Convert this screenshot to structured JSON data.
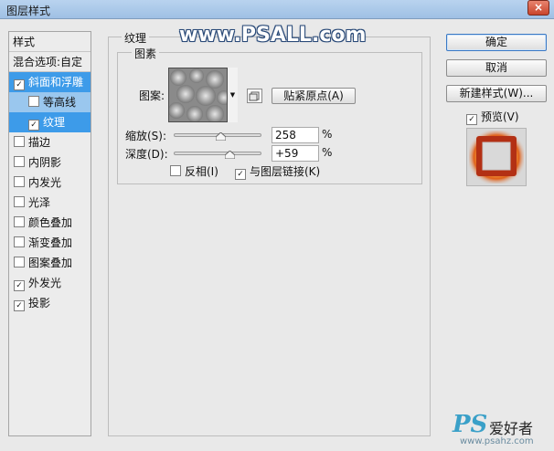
{
  "window": {
    "title": "图层样式",
    "close_glyph": "×"
  },
  "left_panel": {
    "header": "样式",
    "blend_options": "混合选项:自定",
    "items": [
      {
        "label": "斜面和浮雕",
        "checked": true
      },
      {
        "label": "等高线",
        "checked": false
      },
      {
        "label": "纹理",
        "checked": true
      },
      {
        "label": "描边",
        "checked": false
      },
      {
        "label": "内阴影",
        "checked": false
      },
      {
        "label": "内发光",
        "checked": false
      },
      {
        "label": "光泽",
        "checked": false
      },
      {
        "label": "颜色叠加",
        "checked": false
      },
      {
        "label": "渐变叠加",
        "checked": false
      },
      {
        "label": "图案叠加",
        "checked": false
      },
      {
        "label": "外发光",
        "checked": true
      },
      {
        "label": "投影",
        "checked": true
      }
    ]
  },
  "texture_group": {
    "title": "纹理",
    "elements_title": "图素",
    "pattern_label": "图案:",
    "snap_origin_button": "贴紧原点(A)",
    "scale": {
      "label": "缩放(S):",
      "value": "258",
      "unit": "%",
      "slider_fraction": 0.54
    },
    "depth": {
      "label": "深度(D):",
      "value": "+59",
      "unit": "%",
      "slider_fraction": 0.64
    },
    "invert": {
      "label": "反相(I)",
      "checked": false
    },
    "link_with_layer": {
      "label": "与图层链接(K)",
      "checked": true
    }
  },
  "buttons": {
    "ok": "确定",
    "cancel": "取消",
    "new_style": "新建样式(W)...",
    "preview": {
      "label": "预览(V)",
      "checked": true
    }
  },
  "watermarks": {
    "top": "www.PSALL.com",
    "bottom_logo_ps": "PS",
    "bottom_logo_cn": "爱好者",
    "bottom_url": "www.psahz.com"
  },
  "colors": {
    "selection_blue": "#3d9be9",
    "selection_light": "#9ac7ee",
    "close_red": "#c9452c",
    "title_bar": "#b9d3ef"
  }
}
